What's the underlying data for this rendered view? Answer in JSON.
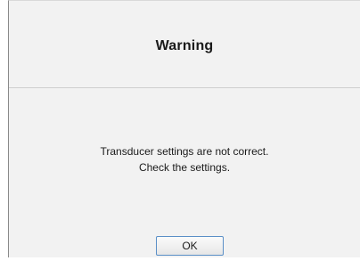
{
  "dialog": {
    "title": "Warning",
    "message_lines": [
      "Transducer settings are not correct.",
      "Check the settings."
    ],
    "ok_label": "OK"
  }
}
